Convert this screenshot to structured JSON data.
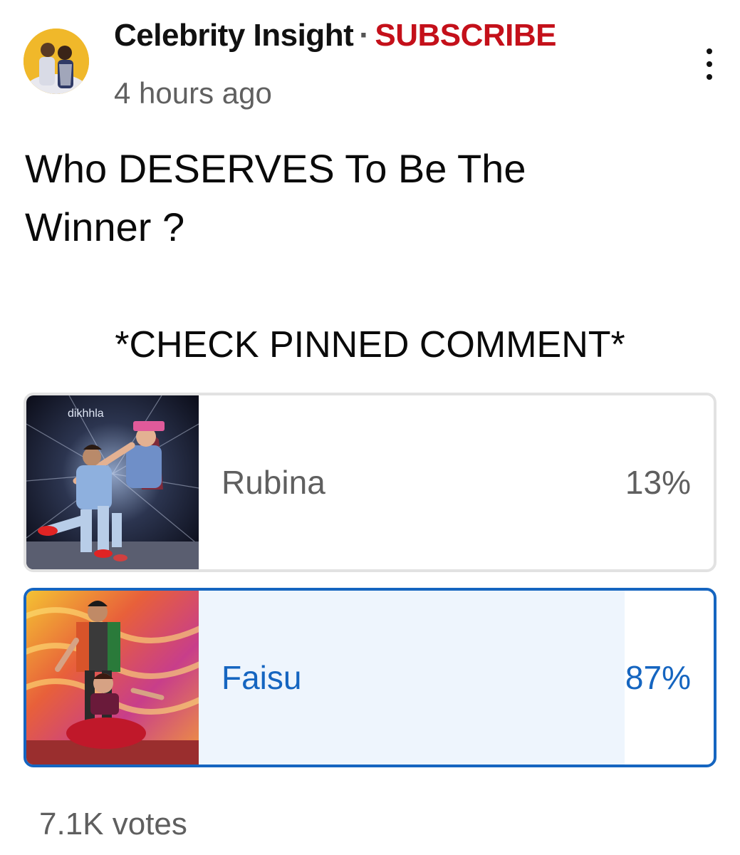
{
  "header": {
    "channel_name": "Celebrity Insight",
    "separator": "·",
    "subscribe_label": "SUBSCRIBE",
    "time_ago": "4 hours ago",
    "avatar_icon": "channel-avatar-icon",
    "menu_icon": "more-vertical-icon"
  },
  "post": {
    "title": "Who DESERVES To Be The Winner ?",
    "note": "*CHECK PINNED COMMENT*"
  },
  "poll": {
    "options": [
      {
        "label": "Rubina",
        "percent_text": "13%",
        "share": 0.13,
        "selected": false,
        "thumbnail_icon": "rubina-thumbnail-image",
        "thumbnail_caption": "dikhhla"
      },
      {
        "label": "Faisu",
        "percent_text": "87%",
        "share": 0.87,
        "selected": true,
        "thumbnail_icon": "faisu-thumbnail-image"
      }
    ],
    "votes": "7.1K votes"
  },
  "colors": {
    "subscribe": "#c4101a",
    "selected_accent": "#1565c0",
    "selected_fill": "#eef5fd",
    "unselected_fill": "#e4e4e4",
    "unselected_border": "#e2e2e2",
    "avatar_background": "#f0b82a"
  }
}
